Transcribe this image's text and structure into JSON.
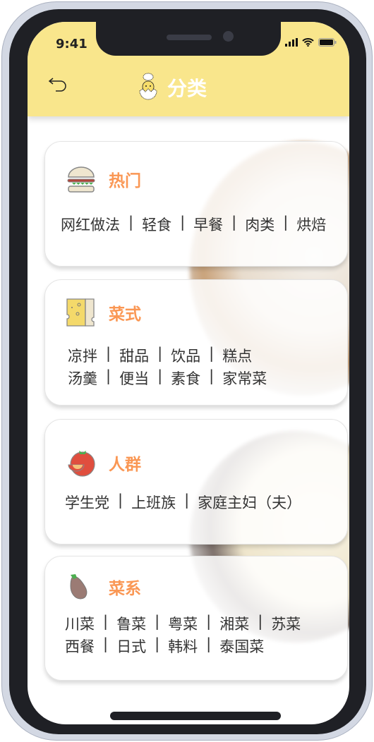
{
  "status": {
    "time": "9:41"
  },
  "header": {
    "title": "分类",
    "colors": {
      "header_bg": "#f9e68c",
      "accent": "#fa9754"
    }
  },
  "cards": [
    {
      "title": "热门",
      "icon": "burger-icon",
      "lines": [
        [
          "网红做法",
          "轻食",
          "早餐",
          "肉类",
          "烘焙"
        ]
      ]
    },
    {
      "title": "菜式",
      "icon": "cheese-icon",
      "lines": [
        [
          "凉拌",
          "甜品",
          "饮品",
          "糕点"
        ],
        [
          "汤羹",
          "便当",
          "素食",
          "家常菜"
        ]
      ]
    },
    {
      "title": "人群",
      "icon": "tomato-icon",
      "lines": [
        [
          "学生党",
          "上班族",
          "家庭主妇（夫）"
        ]
      ]
    },
    {
      "title": "菜系",
      "icon": "eggplant-icon",
      "lines": [
        [
          "川菜",
          "鲁菜",
          "粤菜",
          "湘菜",
          "苏菜"
        ],
        [
          "西餐",
          "日式",
          "韩料",
          "泰国菜"
        ]
      ]
    }
  ]
}
